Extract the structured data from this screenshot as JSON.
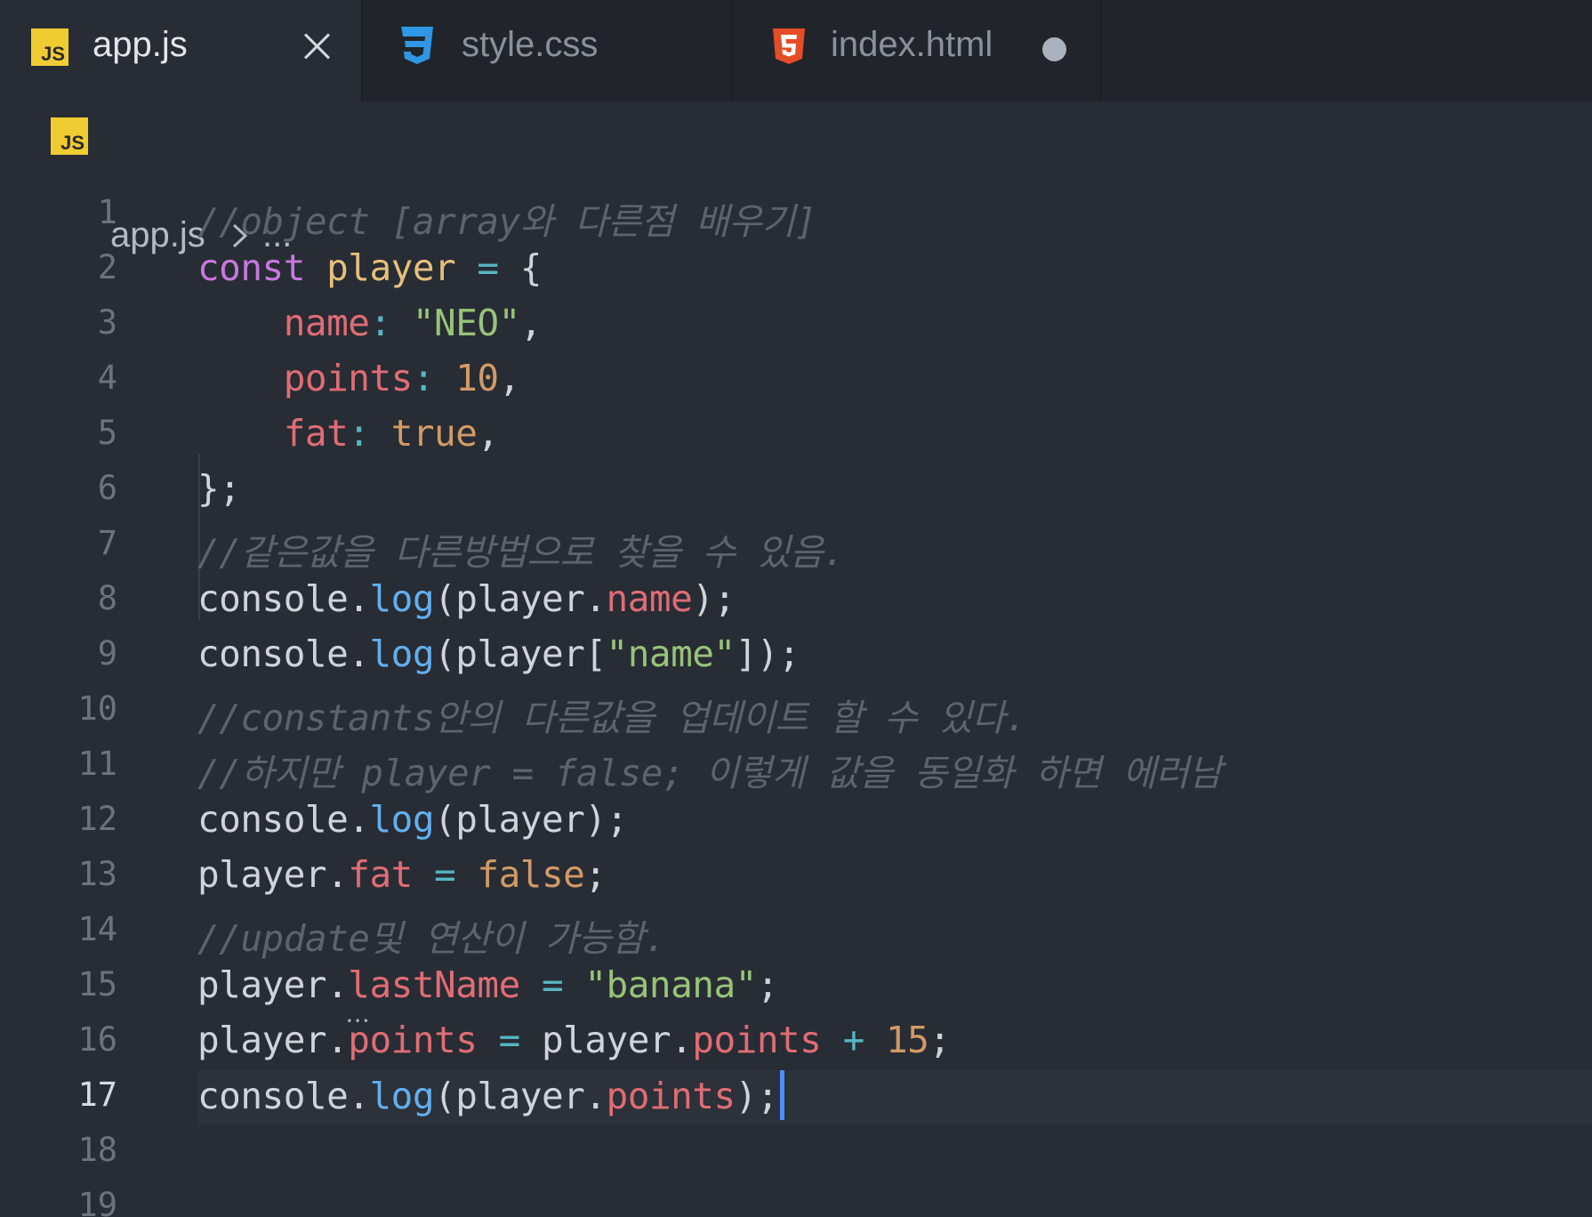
{
  "tabs": [
    {
      "label": "app.js",
      "icon": "js-file-icon",
      "active": true
    },
    {
      "label": "style.css",
      "icon": "css3-file-icon",
      "active": false
    },
    {
      "label": "index.html",
      "icon": "html5-file-icon",
      "active": false,
      "modified": true
    }
  ],
  "breadcrumb": {
    "file": "app.js",
    "more": "..."
  },
  "js_badge": "JS",
  "current_line": 17,
  "colors": {
    "keyword": "#c678dd",
    "string": "#98c379",
    "number": "#d19a66",
    "property": "#e06c75",
    "function": "#61afef",
    "comment": "#5c6370",
    "cursor": "#528bff"
  },
  "lines": [
    {
      "n": "1",
      "tokens": [
        {
          "t": "c",
          "v": "//object [array와 다른점 배우기]"
        }
      ]
    },
    {
      "n": "2",
      "tokens": [
        {
          "t": "k",
          "v": "const"
        },
        {
          "t": "p",
          "v": " "
        },
        {
          "t": "v",
          "v": "player"
        },
        {
          "t": "p",
          "v": " "
        },
        {
          "t": "o",
          "v": "="
        },
        {
          "t": "p",
          "v": " {"
        }
      ]
    },
    {
      "n": "3",
      "tokens": [
        {
          "t": "p",
          "v": "    "
        },
        {
          "t": "pr",
          "v": "name"
        },
        {
          "t": "o",
          "v": ":"
        },
        {
          "t": "p",
          "v": " "
        },
        {
          "t": "s",
          "v": "\"NEO\""
        },
        {
          "t": "p",
          "v": ","
        }
      ]
    },
    {
      "n": "4",
      "tokens": [
        {
          "t": "p",
          "v": "    "
        },
        {
          "t": "pr",
          "v": "points"
        },
        {
          "t": "o",
          "v": ":"
        },
        {
          "t": "p",
          "v": " "
        },
        {
          "t": "n",
          "v": "10"
        },
        {
          "t": "p",
          "v": ","
        }
      ]
    },
    {
      "n": "5",
      "tokens": [
        {
          "t": "p",
          "v": "    "
        },
        {
          "t": "pr",
          "v": "fat"
        },
        {
          "t": "o",
          "v": ":"
        },
        {
          "t": "p",
          "v": " "
        },
        {
          "t": "n",
          "v": "true"
        },
        {
          "t": "p",
          "v": ","
        }
      ]
    },
    {
      "n": "6",
      "tokens": [
        {
          "t": "p",
          "v": "};"
        }
      ]
    },
    {
      "n": "7",
      "tokens": [
        {
          "t": "c",
          "v": "//같은값을 다른방법으로 찾을 수 있음."
        }
      ]
    },
    {
      "n": "8",
      "tokens": [
        {
          "t": "p",
          "v": "console."
        },
        {
          "t": "f",
          "v": "log"
        },
        {
          "t": "p",
          "v": "(player."
        },
        {
          "t": "pr",
          "v": "name"
        },
        {
          "t": "p",
          "v": ");"
        }
      ]
    },
    {
      "n": "9",
      "tokens": [
        {
          "t": "p",
          "v": "console."
        },
        {
          "t": "f",
          "v": "log"
        },
        {
          "t": "p",
          "v": "(player["
        },
        {
          "t": "s",
          "v": "\"name\""
        },
        {
          "t": "p",
          "v": "]);"
        }
      ]
    },
    {
      "n": "10",
      "tokens": [
        {
          "t": "c",
          "v": "//constants안의 다른값을 업데이트 할 수 있다."
        }
      ]
    },
    {
      "n": "11",
      "tokens": [
        {
          "t": "c",
          "v": "//하지만 player = false; 이렇게 값을 동일화 하면 에러남"
        }
      ]
    },
    {
      "n": "12",
      "tokens": [
        {
          "t": "p",
          "v": "console."
        },
        {
          "t": "f",
          "v": "log"
        },
        {
          "t": "p",
          "v": "(player);"
        }
      ]
    },
    {
      "n": "13",
      "tokens": [
        {
          "t": "p",
          "v": "player."
        },
        {
          "t": "pr",
          "v": "fat"
        },
        {
          "t": "p",
          "v": " "
        },
        {
          "t": "o",
          "v": "="
        },
        {
          "t": "p",
          "v": " "
        },
        {
          "t": "n",
          "v": "false"
        },
        {
          "t": "p",
          "v": ";"
        }
      ]
    },
    {
      "n": "14",
      "tokens": [
        {
          "t": "c",
          "v": "//update및 연산이 가능함."
        }
      ]
    },
    {
      "n": "15",
      "tokens": [
        {
          "t": "p",
          "v": "player."
        },
        {
          "t": "pr sq",
          "v": "lastName"
        },
        {
          "t": "p",
          "v": " "
        },
        {
          "t": "o",
          "v": "="
        },
        {
          "t": "p",
          "v": " "
        },
        {
          "t": "s",
          "v": "\"banana\""
        },
        {
          "t": "p",
          "v": ";"
        }
      ]
    },
    {
      "n": "16",
      "tokens": [
        {
          "t": "p",
          "v": "player."
        },
        {
          "t": "pr",
          "v": "points"
        },
        {
          "t": "p",
          "v": " "
        },
        {
          "t": "o",
          "v": "="
        },
        {
          "t": "p",
          "v": " player."
        },
        {
          "t": "pr",
          "v": "points"
        },
        {
          "t": "p",
          "v": " "
        },
        {
          "t": "o",
          "v": "+"
        },
        {
          "t": "p",
          "v": " "
        },
        {
          "t": "n",
          "v": "15"
        },
        {
          "t": "p",
          "v": ";"
        }
      ]
    },
    {
      "n": "17",
      "tokens": [
        {
          "t": "p",
          "v": "console."
        },
        {
          "t": "f",
          "v": "log"
        },
        {
          "t": "p",
          "v": "(player."
        },
        {
          "t": "pr",
          "v": "points"
        },
        {
          "t": "p",
          "v": ");"
        }
      ]
    },
    {
      "n": "18",
      "tokens": []
    },
    {
      "n": "19",
      "tokens": []
    }
  ]
}
